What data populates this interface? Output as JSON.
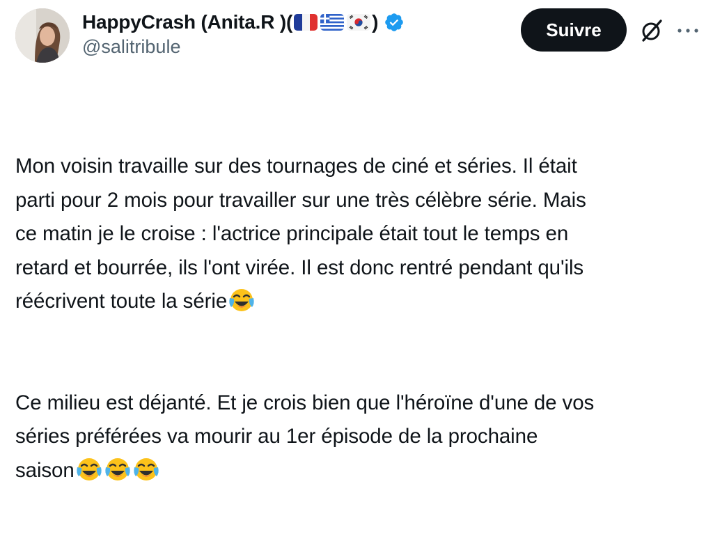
{
  "author": {
    "display_name": "HappyCrash (Anita.R )(",
    "display_name_close": ")",
    "handle": "@salitribule",
    "flags": [
      "flag-france",
      "flag-greece",
      "flag-south-korea"
    ],
    "verified_color": "#1d9bf0"
  },
  "actions": {
    "follow_label": "Suivre"
  },
  "tweet": {
    "paragraph_1_lines": [
      "Mon voisin travaille sur des tournages de ciné et séries. Il était",
      "parti pour 2 mois pour travailler sur une très célèbre série. Mais",
      "ce matin je le croise : l'actrice principale était tout le temps en",
      "retard et bourrée, ils l'ont virée. Il est donc rentré pendant qu'ils",
      "réécrivent toute la série"
    ],
    "paragraph_2_lines": [
      "Ce milieu est déjanté. Et je crois bien que l'héroïne d'une de vos",
      "séries préférées va mourir au 1er épisode de la prochaine",
      "saison"
    ],
    "emoji": "face-with-tears-of-joy-icon"
  },
  "colors": {
    "text": "#0f1419",
    "secondary": "#536471",
    "button_bg": "#0f1419",
    "button_text": "#ffffff"
  }
}
